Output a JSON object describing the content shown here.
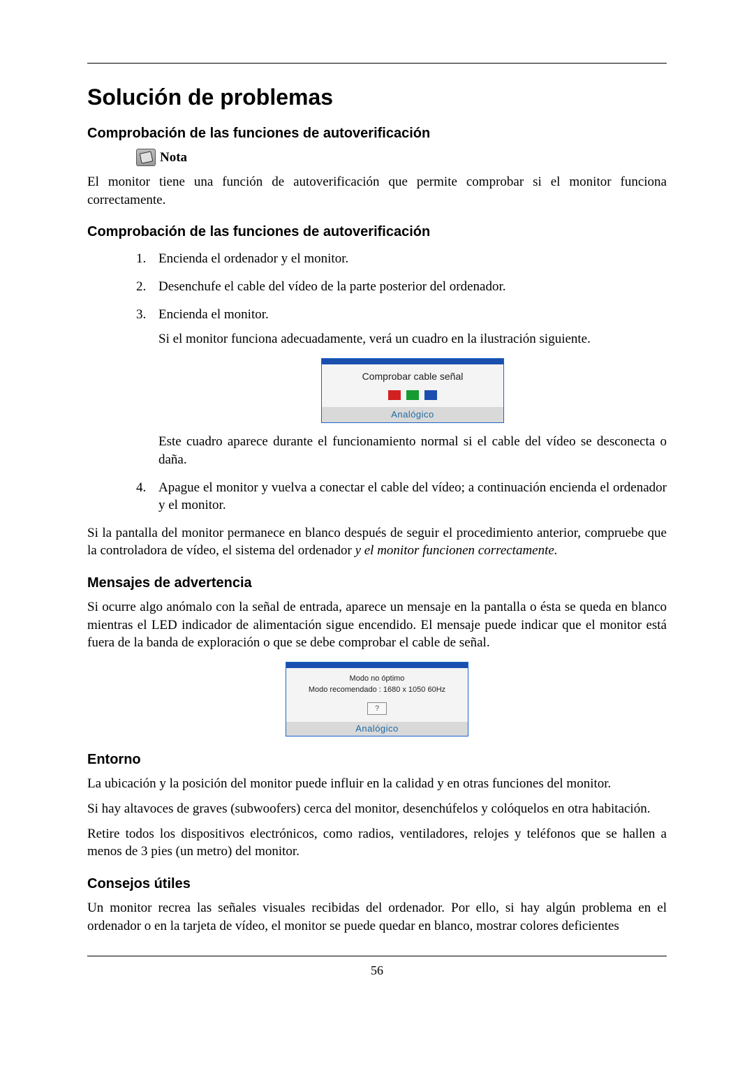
{
  "title": "Solución de problemas",
  "section1": {
    "heading": "Comprobación de las funciones de autoverificación",
    "note_label": "Nota",
    "note_body": "El monitor tiene una función de autoverificación que permite comprobar si el monitor funciona correctamente."
  },
  "section2": {
    "heading": "Comprobación de las funciones de autoverificación",
    "steps": {
      "s1": "Encienda el ordenador y el monitor.",
      "s2": "Desenchufe el cable del vídeo de la parte posterior del ordenador.",
      "s3": "Encienda el monitor.",
      "s3_sub": "Si el monitor funciona adecuadamente, verá un cuadro en la ilustración siguiente.",
      "s3_after": "Este cuadro aparece durante el funcionamiento normal si el cable del vídeo se desconecta o daña.",
      "s4": "Apague el monitor y vuelva a conectar el cable del vídeo; a continuación encienda el ordenador y el monitor."
    },
    "after_steps": "Si la pantalla del monitor permanece en blanco después de seguir el procedimiento anterior, compruebe que la controladora de vídeo, el sistema del ordenador ",
    "after_steps_italic": "y el monitor funcionen correctamente."
  },
  "osd1": {
    "title": "Comprobar cable señal",
    "footer": "Analógico"
  },
  "section3": {
    "heading": "Mensajes de advertencia",
    "body": "Si ocurre algo anómalo con la señal de entrada, aparece un mensaje en la pantalla o ésta se queda en blanco mientras el LED indicador de alimentación sigue encendido. El mensaje puede indicar que el monitor está fuera de la banda de exploración o que se debe comprobar el cable de señal."
  },
  "osd2": {
    "line1": "Modo no óptimo",
    "line2": "Modo recomendado : 1680 x 1050  60Hz",
    "q": "?",
    "footer": "Analógico"
  },
  "section4": {
    "heading": "Entorno",
    "p1": "La ubicación y la posición del monitor puede influir en la calidad y en otras funciones del monitor.",
    "p2": "Si hay altavoces de graves (subwoofers) cerca del monitor, desenchúfelos y colóquelos en otra habitación.",
    "p3": "Retire todos los dispositivos electrónicos, como radios, ventiladores, relojes y teléfonos que se hallen a menos de 3 pies (un metro) del monitor."
  },
  "section5": {
    "heading": "Consejos útiles",
    "p1": "Un monitor recrea las señales visuales recibidas del ordenador. Por ello, si hay algún problema en el ordenador o en la tarjeta de vídeo, el monitor se puede quedar en blanco, mostrar colores deficientes"
  },
  "page_number": "56"
}
